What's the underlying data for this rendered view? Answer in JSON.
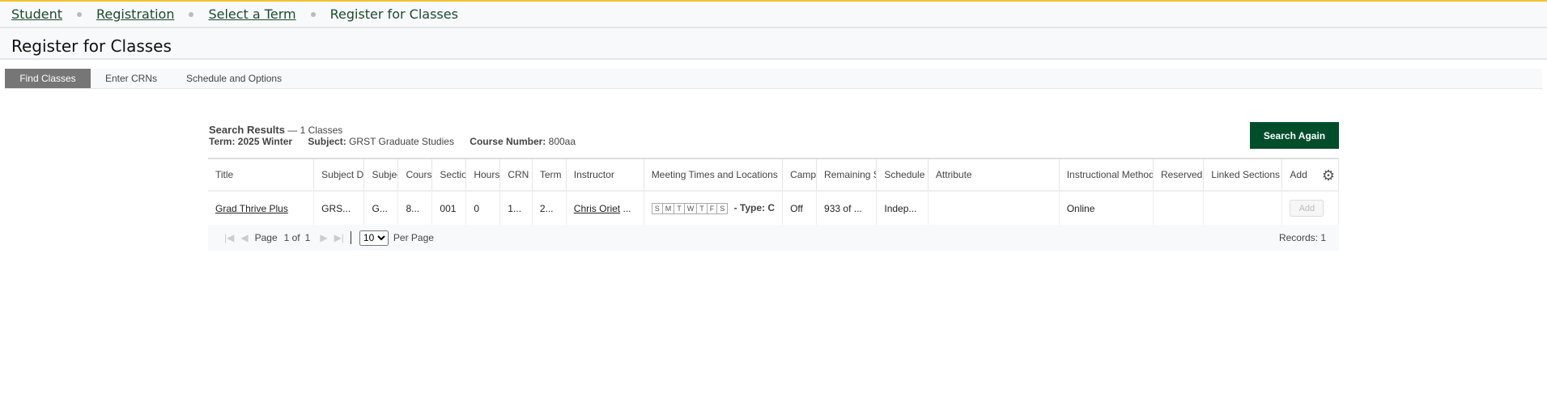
{
  "breadcrumb": [
    "Student",
    "Registration",
    "Select a Term",
    "Register for Classes"
  ],
  "page_title": "Register for Classes",
  "tabs": [
    "Find Classes",
    "Enter CRNs",
    "Schedule and Options"
  ],
  "results": {
    "heading": "Search Results",
    "count": "— 1 Classes",
    "term_label": "Term:",
    "term": "2025 Winter",
    "subject_label": "Subject:",
    "subject": "GRST Graduate Studies",
    "course_label": "Course Number:",
    "course": "800aa"
  },
  "search_again": "Search Again",
  "columns": [
    "Title",
    "Subject Description",
    "Subject",
    "Course Number",
    "Section",
    "Hours",
    "CRN",
    "Term",
    "Instructor",
    "Meeting Times and Locations",
    "Campus",
    "Remaining Seats",
    "Schedule Type",
    "Attribute",
    "Instructional Method",
    "Reserved",
    "Linked Sections",
    "Add"
  ],
  "row": {
    "title": "Grad Thrive Plus",
    "subject_desc": "GRS...",
    "subject": "G...",
    "course": "8...",
    "section": "001",
    "hours": "0",
    "crn": "1...",
    "term": "2...",
    "instructor": "Chris Oriet",
    "instructor_more": "...",
    "days": [
      "S",
      "M",
      "T",
      "W",
      "T",
      "F",
      "S"
    ],
    "type": "- Type: C",
    "campus": "Off",
    "seats": "933 of ...",
    "schedule": "Indep...",
    "attribute": "",
    "method": "Online",
    "reserved": "",
    "linked": "",
    "add": "Add"
  },
  "pager": {
    "page_label": "Page",
    "page": "1 of",
    "total": "1",
    "per_page": "10",
    "per_page_label": "Per Page",
    "records": "Records: 1"
  },
  "colors": {
    "accent": "#004d2b",
    "top_bar": "#f5c12e",
    "active_tab": "#767676"
  }
}
